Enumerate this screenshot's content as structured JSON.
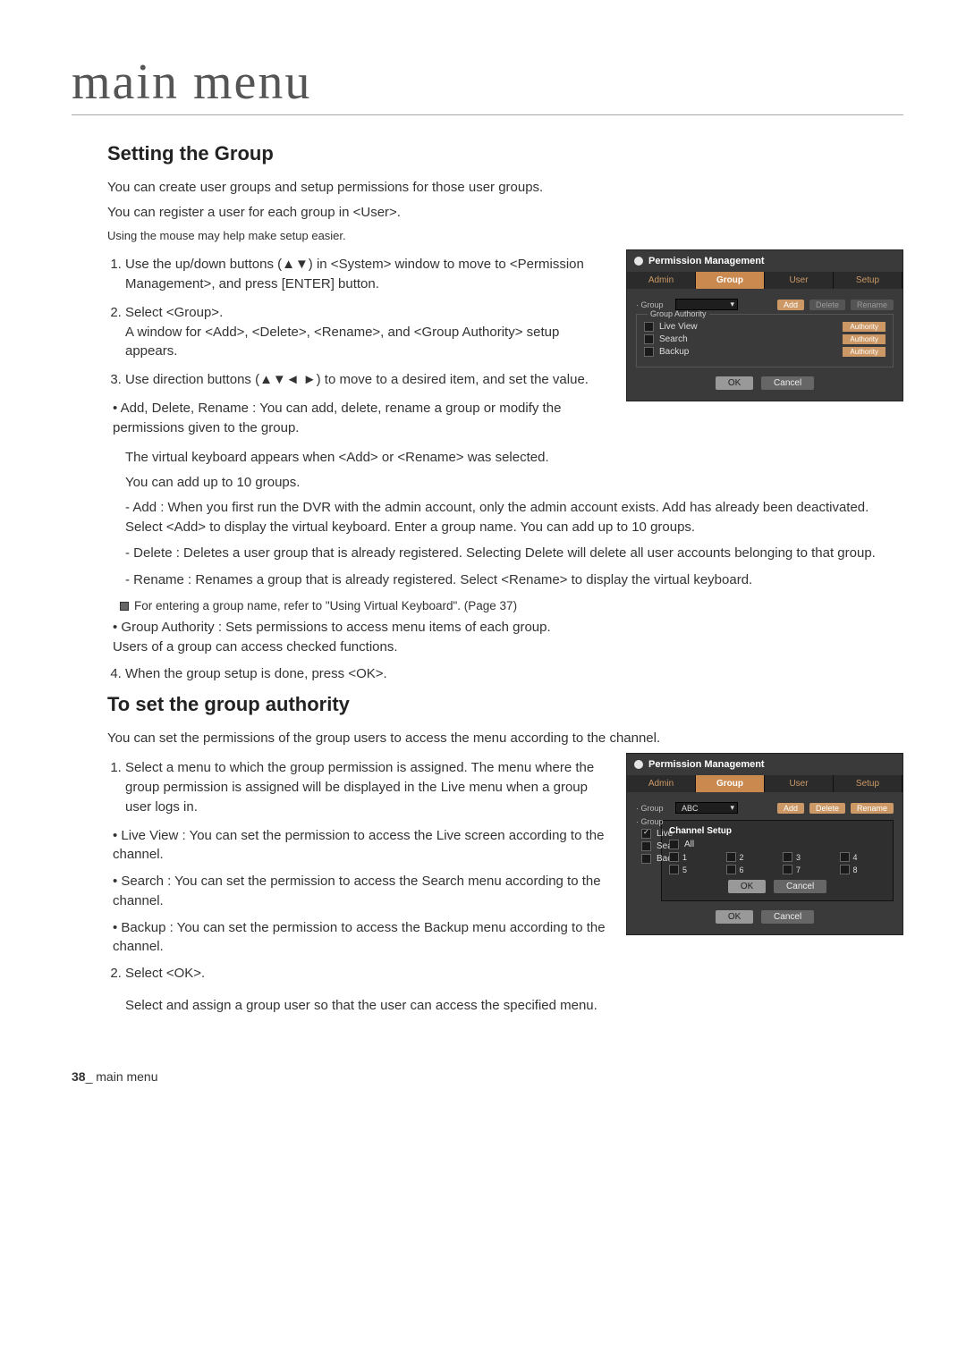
{
  "chapter": "main menu",
  "section1": {
    "heading": "Setting the Group",
    "intro1": "You can create user groups and setup permissions for those user groups.",
    "intro2": "You can register a user for each group in <User>.",
    "tip": "Using the mouse may help make setup easier.",
    "step1": "Use the up/down buttons (▲▼) in <System> window to move to <Permission Management>, and press [ENTER] button.",
    "step2a": "Select <Group>.",
    "step2b": "A window for <Add>, <Delete>, <Rename>, and <Group Authority> setup appears.",
    "step3": "Use direction buttons (▲▼◄ ►) to move to a desired item, and set the value.",
    "bullet_adr_title": "Add, Delete, Rename : You can add, delete, rename a group or modify the permissions given to the group.",
    "bullet_adr_sub1": "The virtual keyboard appears when <Add> or <Rename> was selected.",
    "bullet_adr_sub2": "You can add up to 10 groups.",
    "dash_add": "Add : When you first run the DVR with the admin account, only the admin account exists. Add has already been deactivated. Select <Add> to display the virtual keyboard. Enter a group name. You can add up to 10 groups.",
    "dash_delete": "Delete : Deletes a user group that is already registered. Selecting Delete will delete all user accounts belonging to that group.",
    "dash_rename": "Rename : Renames a group that is already registered. Select <Rename> to display the virtual keyboard.",
    "note": "For entering a group name, refer to \"Using Virtual Keyboard\". (Page 37)",
    "bullet_ga_a": "Group Authority : Sets permissions to access menu items of each group.",
    "bullet_ga_b": "Users of a group can access checked functions.",
    "step4": "When the group setup is done, press <OK>."
  },
  "section2": {
    "heading": "To set the group authority",
    "intro": "You can set the permissions of the group users to access the menu according to the channel.",
    "step1a": "Select a menu to which the group permission is assigned.",
    "step1b": "The menu where the group permission is assigned will be displayed in the Live menu when a group user logs in.",
    "b_live": "Live View : You can set the permission to access the Live screen according to the channel.",
    "b_search": "Search : You can set the permission to access the Search menu according to the channel.",
    "b_backup": "Backup : You can set the permission to access the Backup menu according to the channel.",
    "step2a": "Select <OK>.",
    "step2b": "Select and assign a group user so that the user can access the specified menu."
  },
  "screenshot": {
    "title": "Permission Management",
    "tabs": {
      "admin": "Admin",
      "group": "Group",
      "user": "User",
      "setup": "Setup"
    },
    "group_label": "· Group",
    "ga_label": "Group Authority",
    "items": {
      "live": "Live View",
      "search": "Search",
      "backup": "Backup"
    },
    "auth_btn": "Authority",
    "add": "Add",
    "delete": "Delete",
    "rename": "Rename",
    "ok": "OK",
    "cancel": "Cancel",
    "dropdown_value": "ABC",
    "popup_title": "Channel Setup",
    "all": "All",
    "channels": [
      "1",
      "2",
      "3",
      "4",
      "5",
      "6",
      "7",
      "8"
    ]
  },
  "footer": {
    "page": "38",
    "label": "_ main menu"
  }
}
